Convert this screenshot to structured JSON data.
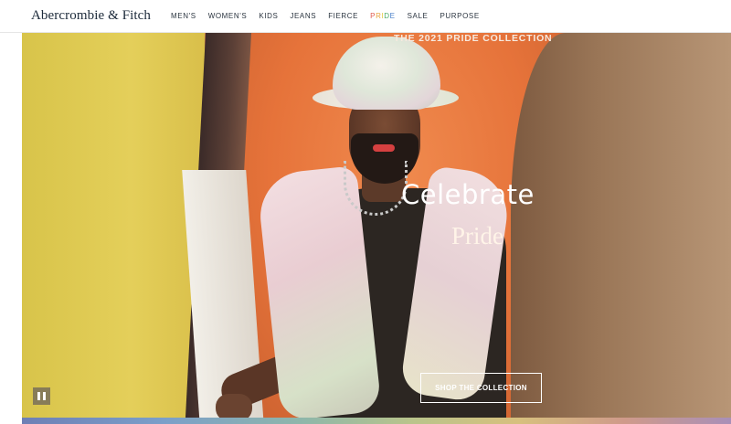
{
  "brand": {
    "logo_text": "Abercrombie & Fitch"
  },
  "nav": {
    "items": [
      {
        "label": "MEN'S"
      },
      {
        "label": "WOMEN'S"
      },
      {
        "label": "KIDS"
      },
      {
        "label": "JEANS"
      },
      {
        "label": "FIERCE"
      },
      {
        "label": "PRIDE"
      },
      {
        "label": "SALE"
      },
      {
        "label": "PURPOSE"
      }
    ],
    "pride_letters": [
      "P",
      "R",
      "I",
      "D",
      "E"
    ]
  },
  "hero": {
    "eyebrow": "THE 2021 PRIDE COLLECTION",
    "headline": "Celebrate",
    "subline": "Pride",
    "cta_label": "SHOP THE COLLECTION",
    "media_control": "pause-icon"
  },
  "colors": {
    "brand_text": "#1c2a3a",
    "pride_red": "#e05a4f",
    "pride_orange": "#e8a23a",
    "pride_yellow": "#e2c93a",
    "pride_green": "#4fae6a",
    "pride_blue": "#4a80c9"
  }
}
